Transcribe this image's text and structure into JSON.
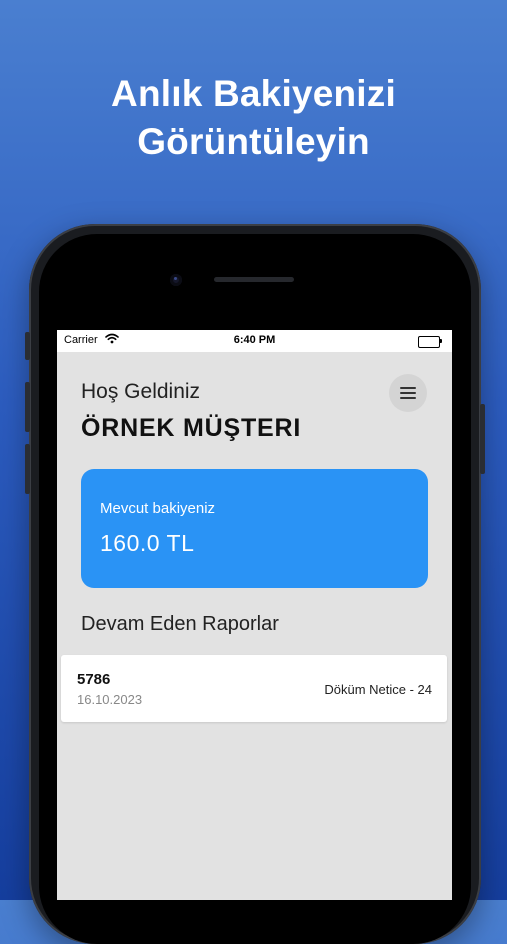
{
  "headline": {
    "line1": "Anlık Bakiyenizi",
    "line2": "Görüntüleyin"
  },
  "status_bar": {
    "carrier": "Carrier",
    "time": "6:40 PM",
    "wifi_icon": "wifi-icon",
    "battery_icon": "battery-icon"
  },
  "header": {
    "greeting": "Hoş Geldiniz",
    "customer_name": "ÖRNEK MÜŞTERI",
    "menu_icon": "hamburger-menu-icon"
  },
  "balance": {
    "label": "Mevcut bakiyeniz",
    "amount": "160.0 TL"
  },
  "reports": {
    "title": "Devam Eden Raporlar",
    "items": [
      {
        "id": "5786",
        "date": "16.10.2023",
        "type": "Döküm Netice - 24"
      }
    ]
  },
  "colors": {
    "accent": "#2a93f5",
    "screen_bg": "#e2e2e2",
    "gradient_top": "#4a7fd0",
    "gradient_bottom": "#153e9e"
  }
}
